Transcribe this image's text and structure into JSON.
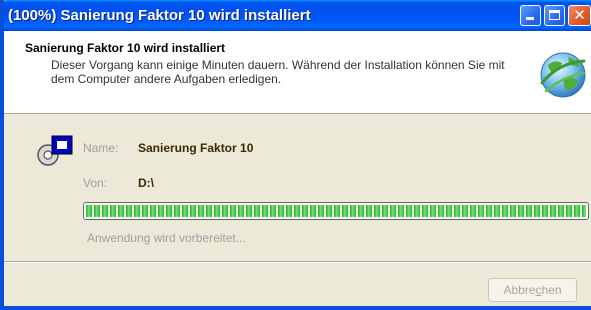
{
  "window": {
    "title": "(100%) Sanierung Faktor 10 wird installiert"
  },
  "header": {
    "title": "Sanierung Faktor 10 wird installiert",
    "description": "Dieser Vorgang kann einige Minuten dauern. Während der Installation können Sie mit dem Computer andere Aufgaben erledigen."
  },
  "details": {
    "name_label": "Name:",
    "name_value": "Sanierung Faktor 10",
    "from_label": "Von:",
    "from_value": "D:\\"
  },
  "progress": {
    "percent": 100,
    "status_text": "Anwendung wird vorbereitet..."
  },
  "buttons": {
    "cancel_pre": "Abbre",
    "cancel_accel": "c",
    "cancel_post": "hen"
  },
  "icons": {
    "minimize": "minimize-icon",
    "maximize": "maximize-icon",
    "close": "close-icon",
    "globe": "globe-icon",
    "app": "application-install-icon"
  },
  "colors": {
    "titlebar": "#0053ee",
    "progress_fill": "#22b422",
    "close_button": "#e05a2a"
  }
}
